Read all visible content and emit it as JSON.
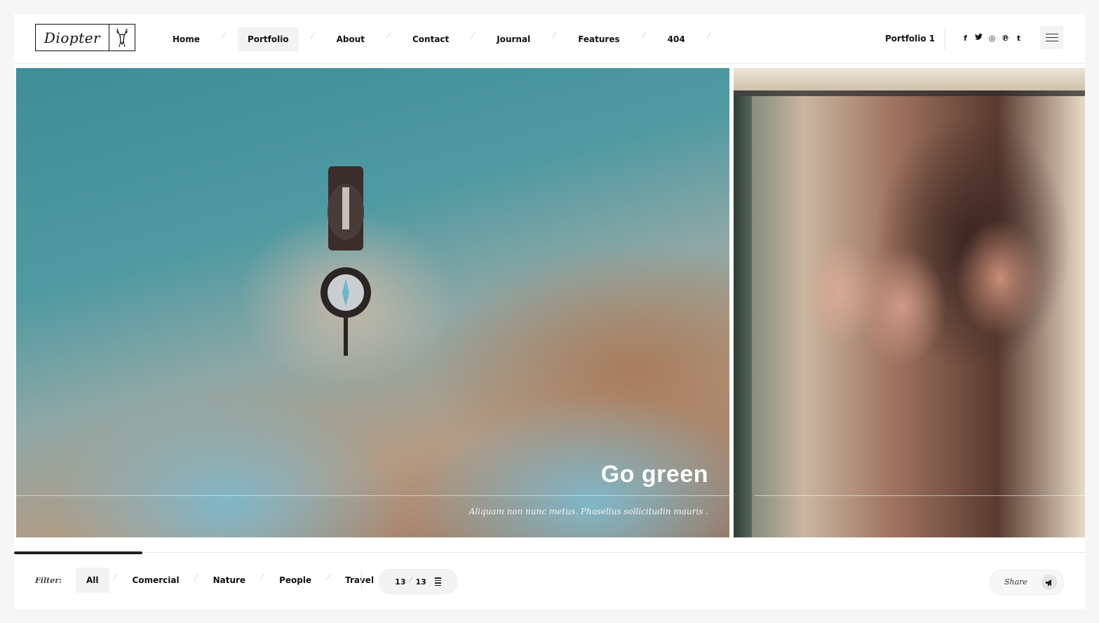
{
  "header": {
    "logo_text": "Diopter",
    "logo_icon": "deer-head-icon",
    "nav": [
      {
        "label": "Home",
        "active": false
      },
      {
        "label": "Portfolio",
        "active": true
      },
      {
        "label": "About",
        "active": false
      },
      {
        "label": "Contact",
        "active": false
      },
      {
        "label": "Journal",
        "active": false
      },
      {
        "label": "Features",
        "active": false
      },
      {
        "label": "404",
        "active": false
      }
    ],
    "page_label": "Portfolio 1",
    "socials": [
      {
        "icon": "facebook-icon",
        "glyph": "f"
      },
      {
        "icon": "twitter-icon",
        "glyph": "t"
      },
      {
        "icon": "instagram-icon",
        "glyph": "◎"
      },
      {
        "icon": "pinterest-icon",
        "glyph": "℗"
      },
      {
        "icon": "tumblr-icon",
        "glyph": "t"
      }
    ],
    "menu_icon": "hamburger-menu-icon"
  },
  "slides": [
    {
      "title": "Go green",
      "subtitle": "Aliquam non nunc metus. Phasellus sollicitudin mauris ."
    },
    {
      "title": "",
      "subtitle": ""
    }
  ],
  "slider": {
    "progress": 0.12
  },
  "footer": {
    "filter_label": "Filter:",
    "filters": [
      {
        "label": "All",
        "active": true
      },
      {
        "label": "Comercial",
        "active": false
      },
      {
        "label": "Nature",
        "active": false
      },
      {
        "label": "People",
        "active": false
      },
      {
        "label": "Travel",
        "active": false
      }
    ],
    "counter": {
      "current": "13",
      "total": "13"
    },
    "grid_icon": "list-view-icon",
    "share_label": "Share",
    "share_icon": "megaphone-icon"
  },
  "colors": {
    "background": "#f6f6f6",
    "panel": "#ffffff",
    "text": "#111111",
    "active_bg": "#f3f3f3"
  }
}
